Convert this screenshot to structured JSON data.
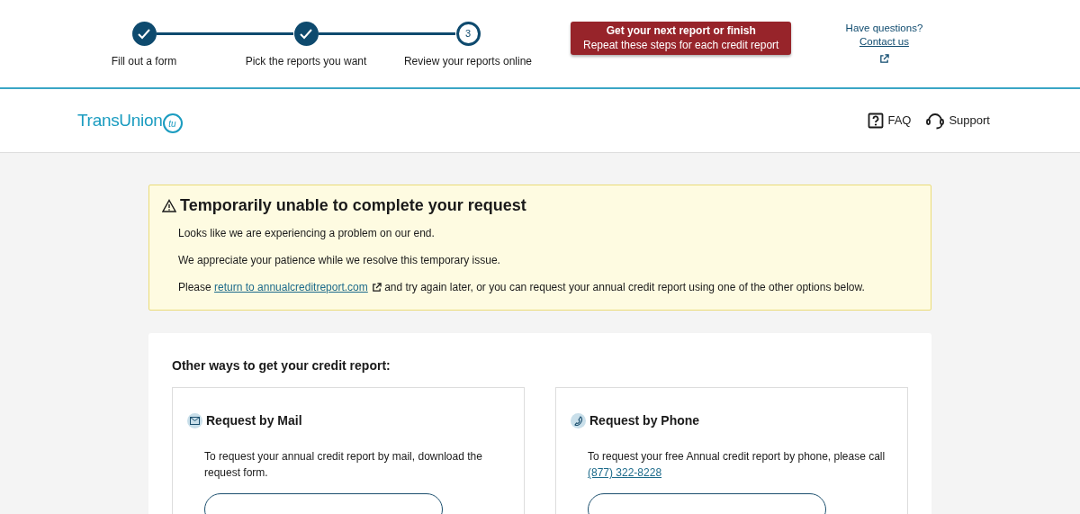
{
  "progress": {
    "steps": [
      {
        "label": "Fill out a form",
        "completed": true
      },
      {
        "label": "Pick the reports you want",
        "completed": true
      },
      {
        "label": "Review your reports online",
        "number": "3",
        "completed": false
      }
    ]
  },
  "next_button": {
    "title": "Get your next report or finish",
    "subtitle": "Repeat these steps for each credit report"
  },
  "help": {
    "question": "Have questions?",
    "link": "Contact us"
  },
  "header": {
    "logo": "TransUnion",
    "logo_badge": "tu",
    "nav": [
      {
        "label": "FAQ",
        "kind": "faq"
      },
      {
        "label": "Support",
        "kind": "support"
      }
    ]
  },
  "alert": {
    "title": "Temporarily unable to complete your request",
    "paragraphs": [
      {
        "text": "Looks like we are experiencing a problem on our end."
      },
      {
        "text": "We appreciate your patience while we resolve this temporary issue."
      },
      {
        "before": "Please ",
        "link": "return to annualcreditreport.com",
        "after": " and try again later, or you can request your annual credit report using one of the other options below."
      }
    ]
  },
  "other_ways": {
    "title": "Other ways to get your credit report:",
    "options": [
      {
        "kind": "mail",
        "title": "Request by Mail",
        "before": "To request your annual credit report by mail, download the request form."
      },
      {
        "kind": "phone",
        "title": "Request by Phone",
        "before": "To request your free Annual credit report by phone, please call ",
        "link": "(877) 322-8228"
      }
    ]
  }
}
